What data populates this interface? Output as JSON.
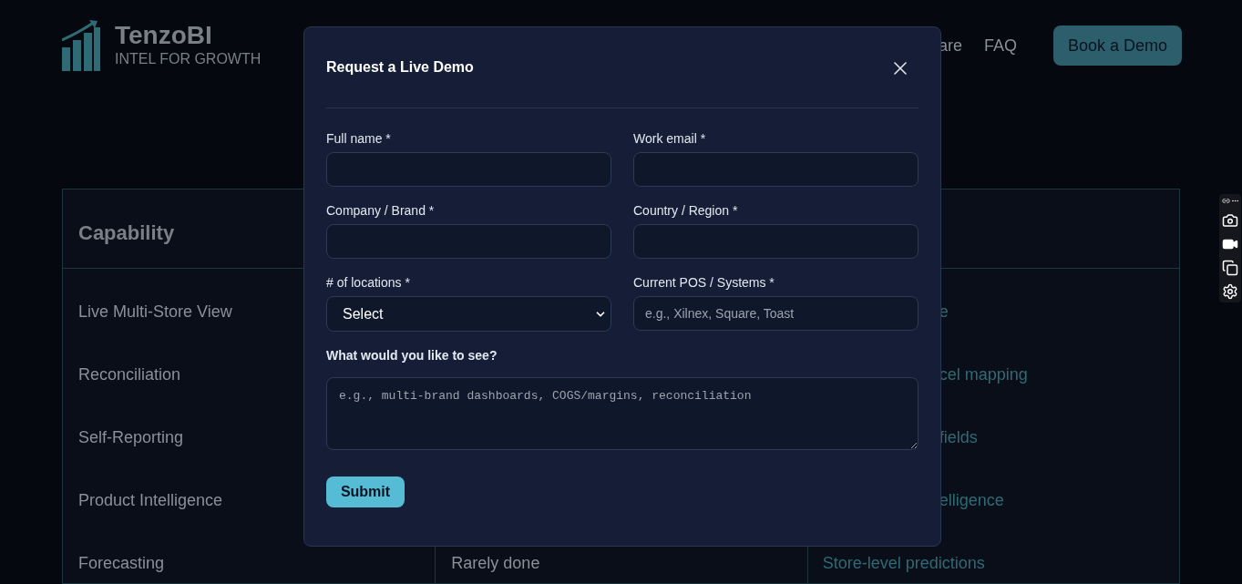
{
  "header": {
    "logo": {
      "name": "TenzoBI",
      "tagline": "INTEL FOR GROWTH"
    },
    "nav": [
      "are",
      "FAQ"
    ],
    "cta": "Book a Demo"
  },
  "table": {
    "heading": "Capability",
    "rows": [
      {
        "capability": "Live Multi-Store View",
        "column_3": "e"
      },
      {
        "capability": "Reconciliation",
        "column_3": "cel mapping"
      },
      {
        "capability": "Self-Reporting",
        "column_3": "fields"
      },
      {
        "capability": "Product Intelligence",
        "column_3": "elligence"
      },
      {
        "capability": "Forecasting",
        "column_2": "Rarely done",
        "column_3": "Store-level predictions"
      }
    ]
  },
  "modal": {
    "title": "Request a Live Demo",
    "fields": [
      {
        "kind": "text",
        "label": "Full name *"
      },
      {
        "kind": "text",
        "label": "Work email *"
      },
      {
        "kind": "text",
        "label": "Company / Brand *"
      },
      {
        "kind": "text",
        "label": "Country / Region *"
      },
      {
        "kind": "select",
        "label": "# of locations *",
        "value": "Select"
      },
      {
        "kind": "text",
        "label": "Current POS / Systems *",
        "placeholder": "e.g., Xilnex, Square, Toast"
      },
      {
        "kind": "textarea",
        "label": "What would you like to see?",
        "placeholder": "e.g., multi-brand dashboards, COGS/margins, reconciliation"
      }
    ],
    "submit": "Submit"
  }
}
